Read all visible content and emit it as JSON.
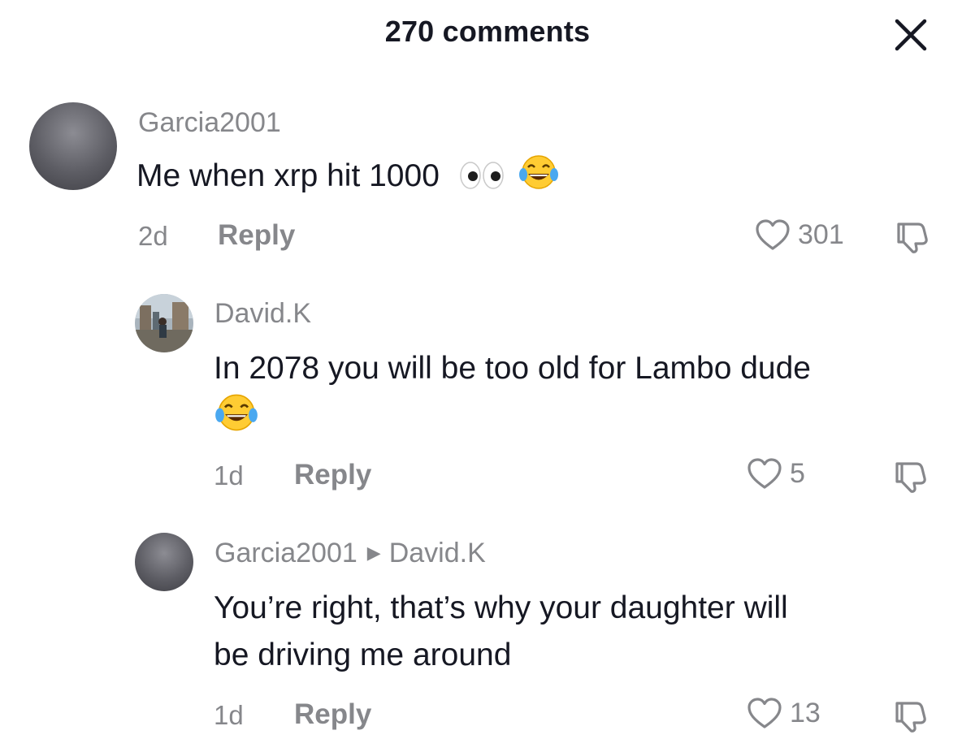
{
  "header": {
    "title": "270 comments"
  },
  "comments": [
    {
      "username": "Garcia2001",
      "text": "Me when xrp hit 1000",
      "emojis": [
        "eyes",
        "face-with-tears-of-joy"
      ],
      "time": "2d",
      "reply_label": "Reply",
      "likes": "301"
    },
    {
      "username": "David.K",
      "text": "In 2078 you will be too old for Lambo dude",
      "emojis": [
        "face-with-tears-of-joy"
      ],
      "time": "1d",
      "reply_label": "Reply",
      "likes": "5"
    },
    {
      "username": "Garcia2001",
      "reply_to": "David.K",
      "text_line1": "You’re right, that’s why your daughter will",
      "text_line2": "be driving me around",
      "time": "1d",
      "reply_label": "Reply",
      "likes": "13"
    }
  ],
  "icons": {
    "close": "close-icon",
    "like": "heart-outline-icon",
    "dislike": "thumbs-down-icon",
    "reply_arrow": "triangle-right-icon"
  },
  "colors": {
    "primary_text": "#161823",
    "secondary_text": "#86878b",
    "background": "#ffffff"
  }
}
